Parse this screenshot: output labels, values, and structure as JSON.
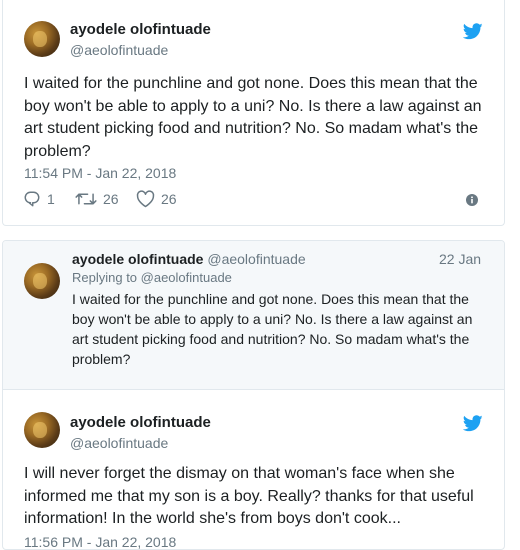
{
  "tweet1": {
    "author_name": "ayodele olofintuade",
    "author_handle": "@aeolofintuade",
    "text": "I waited for the punchline and got none. Does this mean that the boy won't be able to apply to a uni? No. Is there a law against an art student picking food and nutrition? No. So madam what's the problem?",
    "timestamp": "11:54 PM - Jan 22, 2018",
    "replies": "1",
    "retweets": "26",
    "likes": "26"
  },
  "quoted_tweet": {
    "author_name": "ayodele olofintuade",
    "author_handle": "@aeolofintuade",
    "date": "22 Jan",
    "replying_to": "Replying to @aeolofintuade",
    "text": "I waited for the punchline and got none. Does this mean that the boy won't be able to apply to a uni? No. Is there a law against an art student picking food and nutrition? No. So madam what's the problem?"
  },
  "tweet2": {
    "author_name": "ayodele olofintuade",
    "author_handle": "@aeolofintuade",
    "text": "I will never forget the dismay on that woman's face when she informed me that my son is a boy. Really? thanks for that useful information! In the world she's from boys don't cook...",
    "timestamp": "11:56 PM - Jan 22, 2018"
  },
  "colors": {
    "twitter_blue": "#1da1f2",
    "text_primary": "#1c2022",
    "text_secondary": "#697882",
    "border": "#e1e8ed",
    "quoted_bg": "#f5f8fa"
  },
  "icons": {
    "brand": "twitter-bird-icon",
    "reply": "reply-icon",
    "retweet": "retweet-icon",
    "like": "heart-icon",
    "info": "info-icon"
  }
}
